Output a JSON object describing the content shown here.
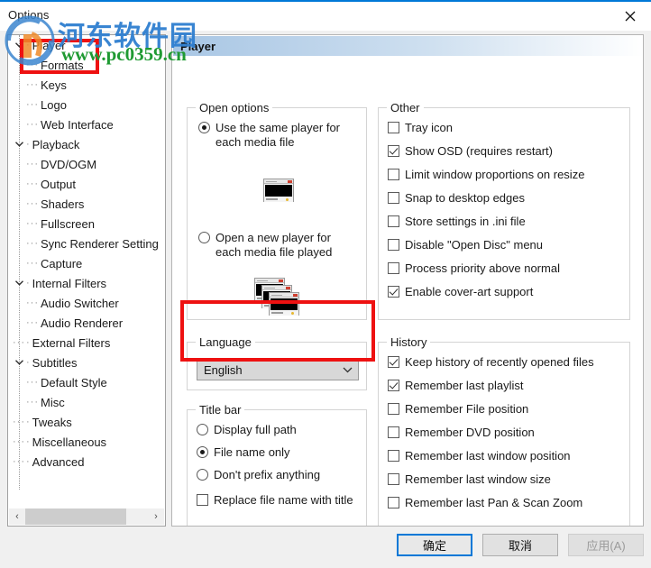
{
  "window": {
    "title": "Options",
    "close_label": "✕"
  },
  "watermark": {
    "site_name_cn": "河东软件园",
    "site_url": "www.pc0359.cn"
  },
  "tree": {
    "items": [
      {
        "label": "Player",
        "level": 0,
        "expanded": true,
        "selected": true
      },
      {
        "label": "Formats",
        "level": 1,
        "expanded": null,
        "selected": false
      },
      {
        "label": "Keys",
        "level": 1,
        "expanded": null,
        "selected": false
      },
      {
        "label": "Logo",
        "level": 1,
        "expanded": null,
        "selected": false
      },
      {
        "label": "Web Interface",
        "level": 1,
        "expanded": null,
        "selected": false
      },
      {
        "label": "Playback",
        "level": 0,
        "expanded": true,
        "selected": false
      },
      {
        "label": "DVD/OGM",
        "level": 1,
        "expanded": null,
        "selected": false
      },
      {
        "label": "Output",
        "level": 1,
        "expanded": null,
        "selected": false
      },
      {
        "label": "Shaders",
        "level": 1,
        "expanded": null,
        "selected": false
      },
      {
        "label": "Fullscreen",
        "level": 1,
        "expanded": null,
        "selected": false
      },
      {
        "label": "Sync Renderer Setting",
        "level": 1,
        "expanded": null,
        "selected": false
      },
      {
        "label": "Capture",
        "level": 1,
        "expanded": null,
        "selected": false
      },
      {
        "label": "Internal Filters",
        "level": 0,
        "expanded": true,
        "selected": false
      },
      {
        "label": "Audio Switcher",
        "level": 1,
        "expanded": null,
        "selected": false
      },
      {
        "label": "Audio Renderer",
        "level": 1,
        "expanded": null,
        "selected": false
      },
      {
        "label": "External Filters",
        "level": 0,
        "expanded": null,
        "selected": false
      },
      {
        "label": "Subtitles",
        "level": 0,
        "expanded": true,
        "selected": false
      },
      {
        "label": "Default Style",
        "level": 1,
        "expanded": null,
        "selected": false
      },
      {
        "label": "Misc",
        "level": 1,
        "expanded": null,
        "selected": false
      },
      {
        "label": "Tweaks",
        "level": 0,
        "expanded": null,
        "selected": false
      },
      {
        "label": "Miscellaneous",
        "level": 0,
        "expanded": null,
        "selected": false
      },
      {
        "label": "Advanced",
        "level": 0,
        "expanded": null,
        "selected": false
      }
    ],
    "scrollbar": {
      "left_arrow": "‹",
      "right_arrow": "›"
    }
  },
  "page": {
    "header": "Player",
    "open_options": {
      "legend": "Open options",
      "choices": [
        {
          "label": "Use the same player for each media file",
          "selected": true
        },
        {
          "label": "Open a new player for each media file played",
          "selected": false
        }
      ]
    },
    "language": {
      "legend": "Language",
      "selected": "English",
      "arrow": "⌄"
    },
    "title_bar": {
      "legend": "Title bar",
      "radios": [
        {
          "label": "Display full path",
          "selected": false
        },
        {
          "label": "File name only",
          "selected": true
        },
        {
          "label": "Don't prefix anything",
          "selected": false
        }
      ],
      "checkbox": {
        "label": "Replace file name with title",
        "checked": false
      }
    },
    "other": {
      "legend": "Other",
      "checkboxes": [
        {
          "label": "Tray icon",
          "checked": false
        },
        {
          "label": "Show OSD (requires restart)",
          "checked": true
        },
        {
          "label": "Limit window proportions on resize",
          "checked": false
        },
        {
          "label": "Snap to desktop edges",
          "checked": false
        },
        {
          "label": "Store settings in .ini file",
          "checked": false
        },
        {
          "label": "Disable \"Open Disc\" menu",
          "checked": false
        },
        {
          "label": "Process priority above normal",
          "checked": false
        },
        {
          "label": "Enable cover-art support",
          "checked": true
        }
      ]
    },
    "history": {
      "legend": "History",
      "checkboxes": [
        {
          "label": "Keep history of recently opened files",
          "checked": true
        },
        {
          "label": "Remember last playlist",
          "checked": true
        },
        {
          "label": "Remember File position",
          "checked": false
        },
        {
          "label": "Remember DVD position",
          "checked": false
        },
        {
          "label": "Remember last window position",
          "checked": false
        },
        {
          "label": "Remember last window size",
          "checked": false
        },
        {
          "label": "Remember last Pan & Scan Zoom",
          "checked": false
        }
      ]
    }
  },
  "buttons": {
    "ok": "确定",
    "cancel": "取消",
    "apply": "应用(A)"
  }
}
